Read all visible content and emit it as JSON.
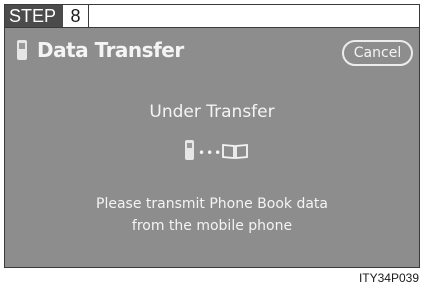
{
  "step": {
    "label": "STEP",
    "number": "8"
  },
  "screen": {
    "title": "Data Transfer",
    "cancel_label": "Cancel",
    "status": "Under Transfer",
    "message_line1": "Please transmit Phone Book data",
    "message_line2": "from the mobile phone",
    "icons": {
      "header": "mobile-phone-icon",
      "source": "mobile-phone-icon",
      "flow": "transfer-dots-icon",
      "destination": "phone-book-icon"
    }
  },
  "figure_code": "ITY34P039",
  "colors": {
    "screen_bg": "#8d8d8d",
    "text": "#f4f4f4",
    "step_bg": "#4b4b4b"
  }
}
